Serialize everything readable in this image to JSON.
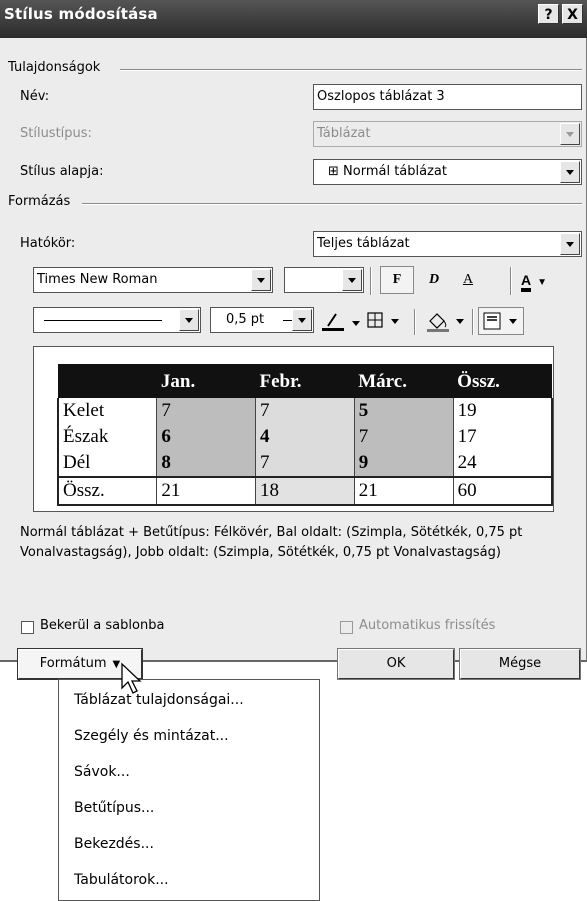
{
  "dialog": {
    "title": "Stílus módosítása",
    "help_label": "?",
    "close_label": "X"
  },
  "properties": {
    "group_label": "Tulajdonságok",
    "name_label": "Név:",
    "name_value": "Oszlopos táblázat 3",
    "style_type_label": "Stílustípus:",
    "style_type_value": "Táblázat",
    "style_based_label": "Stílus alapja:",
    "style_based_value": "⊞ Normál táblázat"
  },
  "formatting": {
    "group_label": "Formázás",
    "scope_label": "Hatókör:",
    "scope_value": "Teljes táblázat",
    "font_value": "Times New Roman",
    "size_value": "",
    "bold_label": "F",
    "italic_label": "D",
    "underline_label": "A",
    "font_color_label": "A",
    "line_width_value": "0,5 pt"
  },
  "preview_table": {
    "headers": [
      "",
      "Jan.",
      "Febr.",
      "Márc.",
      "Össz."
    ],
    "rows": [
      [
        "Kelet",
        "7",
        "7",
        "5",
        "19"
      ],
      [
        "Észak",
        "6",
        "4",
        "7",
        "17"
      ],
      [
        "Dél",
        "8",
        "7",
        "9",
        "24"
      ],
      [
        "Össz.",
        "21",
        "18",
        "21",
        "60"
      ]
    ]
  },
  "description": "Normál táblázat + Betűtípus: Félkövér, Bal oldalt: (Szimpla, Sötétkék, 0,75 pt Vonalvastagság), Jobb oldalt: (Szimpla, Sötétkék,  0,75 pt Vonalvastagság)",
  "options": {
    "add_to_template_label": "Bekerül a sablonba",
    "auto_update_label": "Automatikus frissítés"
  },
  "buttons": {
    "format_label": "Formátum",
    "ok_label": "OK",
    "cancel_label": "Mégse"
  },
  "format_menu": {
    "items": [
      "Táblázat tulajdonságai...",
      "Szegély és mintázat...",
      "Sávok...",
      "Betűtípus...",
      "Bekezdés...",
      "Tabulátorok..."
    ]
  }
}
